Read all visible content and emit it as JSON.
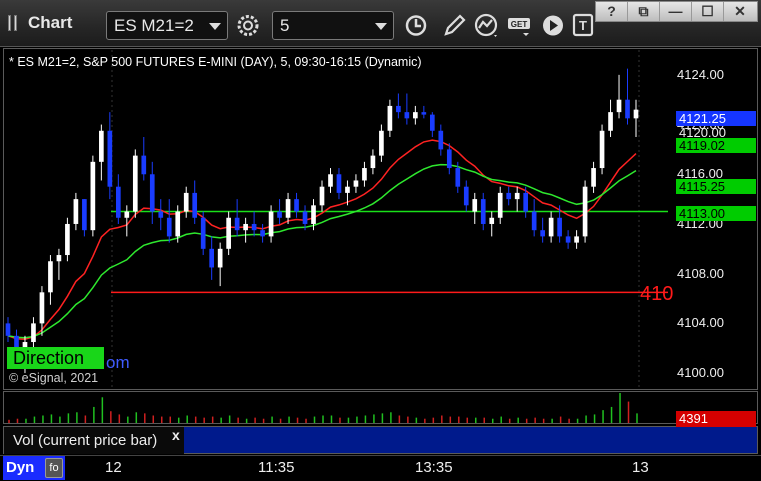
{
  "window": {
    "title": "Chart",
    "symbol": "ES M21=2",
    "interval": "5",
    "buttons": [
      "?",
      "⧉",
      "—",
      "☐",
      "✕"
    ]
  },
  "toolbar": {
    "icons": [
      "settings-icon",
      "clock-icon",
      "pencil-icon",
      "studies-icon",
      "get-icon",
      "play-icon",
      "template-icon"
    ],
    "get_label": "GET"
  },
  "chart": {
    "header": "* ES M21=2, S&P 500 FUTURES E-MINI (DAY), 5, 09:30-16:15 (Dynamic)",
    "direction_label": "Direction",
    "link_text": "om",
    "copyright": "© eSignal, 2021",
    "red_line_label": "410",
    "price_tags": [
      {
        "label": "4121.25",
        "bg": "#1535ff",
        "fg": "#ffffff"
      },
      {
        "label": "4120.00",
        "bg": "none",
        "fg": "#eeeeee"
      },
      {
        "label": "4119.02",
        "bg": "#00cc00",
        "fg": "#000000"
      },
      {
        "label": "4115.25",
        "bg": "#00cc00",
        "fg": "#000000"
      },
      {
        "label": "4113.00",
        "bg": "#00cc00",
        "fg": "#000000"
      }
    ]
  },
  "volume": {
    "title": "Vol (current price bar)",
    "close_label": "x",
    "value_tag": "4391"
  },
  "bottom": {
    "dyn_label": "Dyn",
    "dyn_icon": "fo",
    "x_labels": [
      "12",
      "11:35",
      "13:35",
      "13"
    ]
  },
  "chart_data": {
    "type": "candlestick",
    "title": "",
    "yticks": [
      4124.0,
      4120.0,
      4116.0,
      4112.0,
      4108.0,
      4104.0,
      4100.0
    ],
    "ylim": [
      4098.8,
      4126.0
    ],
    "up_color": "#ffffff",
    "down_color": "#1a3cff",
    "red_level": 4106.5,
    "green_level": 4113.0,
    "candles": [
      [
        4104.0,
        4104.5,
        4102.5,
        4103.0
      ],
      [
        4103.0,
        4103.5,
        4100.5,
        4101.5
      ],
      [
        4101.5,
        4103.0,
        4100.0,
        4102.5
      ],
      [
        4102.5,
        4104.5,
        4102.0,
        4104.0
      ],
      [
        4104.0,
        4107.0,
        4103.0,
        4106.5
      ],
      [
        4106.5,
        4109.5,
        4105.5,
        4109.0
      ],
      [
        4109.0,
        4110.0,
        4107.5,
        4109.5
      ],
      [
        4109.5,
        4112.5,
        4109.0,
        4112.0
      ],
      [
        4112.0,
        4114.5,
        4111.5,
        4114.0
      ],
      [
        4114.0,
        4114.0,
        4111.0,
        4111.5
      ],
      [
        4111.5,
        4117.5,
        4111.0,
        4117.0
      ],
      [
        4117.0,
        4120.0,
        4115.5,
        4119.5
      ],
      [
        4119.5,
        4121.0,
        4114.0,
        4115.0
      ],
      [
        4115.0,
        4116.0,
        4112.0,
        4112.5
      ],
      [
        4112.5,
        4113.5,
        4111.0,
        4113.0
      ],
      [
        4113.0,
        4118.0,
        4112.5,
        4117.5
      ],
      [
        4117.5,
        4119.0,
        4115.5,
        4116.0
      ],
      [
        4116.0,
        4117.0,
        4112.0,
        4113.0
      ],
      [
        4113.0,
        4114.0,
        4111.5,
        4112.5
      ],
      [
        4112.5,
        4114.0,
        4110.5,
        4111.0
      ],
      [
        4111.0,
        4113.5,
        4110.5,
        4113.0
      ],
      [
        4113.0,
        4115.0,
        4112.5,
        4114.5
      ],
      [
        4114.5,
        4115.5,
        4112.0,
        4112.5
      ],
      [
        4112.5,
        4113.0,
        4109.5,
        4110.0
      ],
      [
        4110.0,
        4111.0,
        4107.5,
        4108.5
      ],
      [
        4108.5,
        4110.5,
        4107.0,
        4110.0
      ],
      [
        4110.0,
        4113.0,
        4109.5,
        4112.5
      ],
      [
        4112.5,
        4114.0,
        4111.0,
        4111.5
      ],
      [
        4111.5,
        4112.5,
        4110.5,
        4112.0
      ],
      [
        4112.0,
        4113.0,
        4111.0,
        4111.5
      ],
      [
        4111.5,
        4112.0,
        4110.5,
        4111.0
      ],
      [
        4111.0,
        4113.5,
        4110.5,
        4113.0
      ],
      [
        4113.0,
        4114.0,
        4112.0,
        4112.5
      ],
      [
        4112.5,
        4114.5,
        4112.0,
        4114.0
      ],
      [
        4114.0,
        4114.5,
        4112.5,
        4113.0
      ],
      [
        4113.0,
        4113.5,
        4111.5,
        4112.0
      ],
      [
        4112.0,
        4114.0,
        4111.5,
        4113.5
      ],
      [
        4113.5,
        4115.5,
        4113.0,
        4115.0
      ],
      [
        4115.0,
        4116.5,
        4114.5,
        4116.0
      ],
      [
        4116.0,
        4116.5,
        4114.0,
        4114.5
      ],
      [
        4114.5,
        4115.5,
        4113.5,
        4115.0
      ],
      [
        4115.0,
        4116.0,
        4114.5,
        4115.5
      ],
      [
        4115.5,
        4117.0,
        4115.0,
        4116.5
      ],
      [
        4116.5,
        4118.0,
        4116.0,
        4117.5
      ],
      [
        4117.5,
        4120.0,
        4117.0,
        4119.5
      ],
      [
        4119.5,
        4122.0,
        4119.0,
        4121.5
      ],
      [
        4121.5,
        4122.5,
        4120.5,
        4121.0
      ],
      [
        4121.0,
        4122.5,
        4120.0,
        4120.5
      ],
      [
        4120.5,
        4121.5,
        4120.0,
        4121.0
      ],
      [
        4121.0,
        4121.5,
        4120.5,
        4120.8
      ],
      [
        4120.8,
        4121.0,
        4119.0,
        4119.5
      ],
      [
        4119.5,
        4120.0,
        4117.5,
        4118.0
      ],
      [
        4118.0,
        4118.5,
        4116.0,
        4116.5
      ],
      [
        4116.5,
        4117.0,
        4114.5,
        4115.0
      ],
      [
        4115.0,
        4115.5,
        4113.0,
        4113.5
      ],
      [
        4113.0,
        4114.5,
        4112.0,
        4114.0
      ],
      [
        4114.0,
        4114.5,
        4111.5,
        4112.0
      ],
      [
        4112.0,
        4113.0,
        4111.0,
        4112.5
      ],
      [
        4112.5,
        4115.0,
        4112.0,
        4114.5
      ],
      [
        4114.5,
        4115.0,
        4113.5,
        4114.0
      ],
      [
        4114.0,
        4115.0,
        4113.0,
        4114.5
      ],
      [
        4114.5,
        4115.0,
        4112.5,
        4113.0
      ],
      [
        4113.0,
        4114.0,
        4111.0,
        4111.5
      ],
      [
        4111.5,
        4112.5,
        4110.5,
        4111.0
      ],
      [
        4111.0,
        4113.0,
        4110.5,
        4112.5
      ],
      [
        4112.5,
        4113.5,
        4110.5,
        4111.0
      ],
      [
        4111.0,
        4111.5,
        4110.0,
        4110.5
      ],
      [
        4110.5,
        4111.5,
        4110.0,
        4111.0
      ],
      [
        4111.0,
        4115.5,
        4110.5,
        4115.0
      ],
      [
        4115.0,
        4117.0,
        4114.5,
        4116.5
      ],
      [
        4116.5,
        4120.0,
        4116.0,
        4119.5
      ],
      [
        4119.5,
        4122.0,
        4119.0,
        4121.0
      ],
      [
        4121.0,
        4124.0,
        4120.5,
        4122.0
      ],
      [
        4122.0,
        4124.5,
        4120.0,
        4120.5
      ],
      [
        4120.5,
        4122.0,
        4119.0,
        4121.2
      ]
    ],
    "volume": [
      3,
      4,
      4,
      6,
      7,
      8,
      6,
      9,
      10,
      7,
      15,
      24,
      11,
      8,
      6,
      10,
      9,
      7,
      6,
      6,
      5,
      7,
      6,
      5,
      6,
      5,
      7,
      5,
      4,
      5,
      4,
      6,
      4,
      6,
      5,
      4,
      6,
      7,
      7,
      5,
      5,
      6,
      7,
      8,
      9,
      10,
      7,
      6,
      5,
      4,
      5,
      7,
      6,
      6,
      5,
      5,
      5,
      4,
      6,
      4,
      5,
      4,
      5,
      4,
      4,
      6,
      4,
      4,
      7,
      8,
      12,
      15,
      28,
      20,
      9
    ]
  }
}
